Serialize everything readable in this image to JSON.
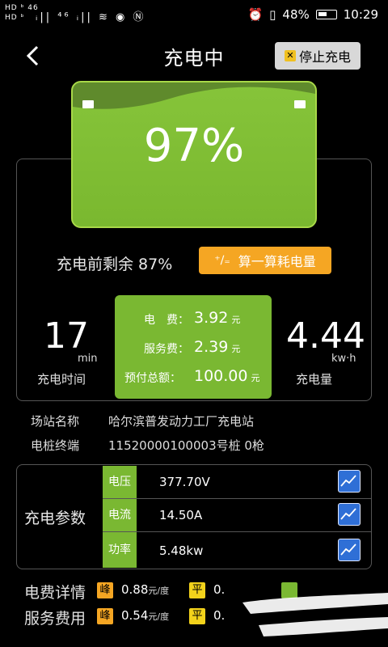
{
  "status_bar": {
    "left_top": "HD ᵇ 46",
    "left_bottom": "HD ᵇ",
    "signal_icons": "ᵢ|| ⁴⁶ ᵢ|| ≋ ◉ Ⓝ",
    "battery_pct": "48%",
    "time": "10:29"
  },
  "header": {
    "title": "充电中",
    "stop_label": "停止充电"
  },
  "battery": {
    "percent": "97%",
    "level": 0.97
  },
  "remain_before": "充电前剩余 87%",
  "calc_button": "算一算耗电量",
  "time_stat": {
    "value": "17",
    "unit": "min",
    "caption": "充电时间"
  },
  "energy_stat": {
    "value": "4.44",
    "unit": "kw·h",
    "caption": "充电量"
  },
  "fees": {
    "electric_label": "电　费：",
    "electric_value": "3.92",
    "service_label": "服务费：",
    "service_value": "2.39",
    "prepaid_label": "预付总额：",
    "prepaid_value": "100.00",
    "unit": "元"
  },
  "station": {
    "name_label": "场站名称",
    "name_value": "哈尔滨普发动力工厂充电站",
    "terminal_label": "电桩终端",
    "terminal_value": "11520000100003号桩 0枪"
  },
  "params": {
    "title": "充电参数",
    "rows": [
      {
        "name": "电压",
        "value": "377.70V"
      },
      {
        "name": "电流",
        "value": "14.50A"
      },
      {
        "name": "功率",
        "value": "5.48kw"
      }
    ]
  },
  "fee_details": {
    "electric_title": "电费详情",
    "service_title": "服务费用",
    "peak_tag": "峰",
    "flat_tag": "平",
    "electric_peak": "0.88",
    "service_peak": "0.54",
    "flat_partial": "0.",
    "price_unit": "元/度"
  },
  "colors": {
    "accent_green": "#7ab832",
    "orange": "#f5a623",
    "chart_blue": "#2f6fd6"
  }
}
